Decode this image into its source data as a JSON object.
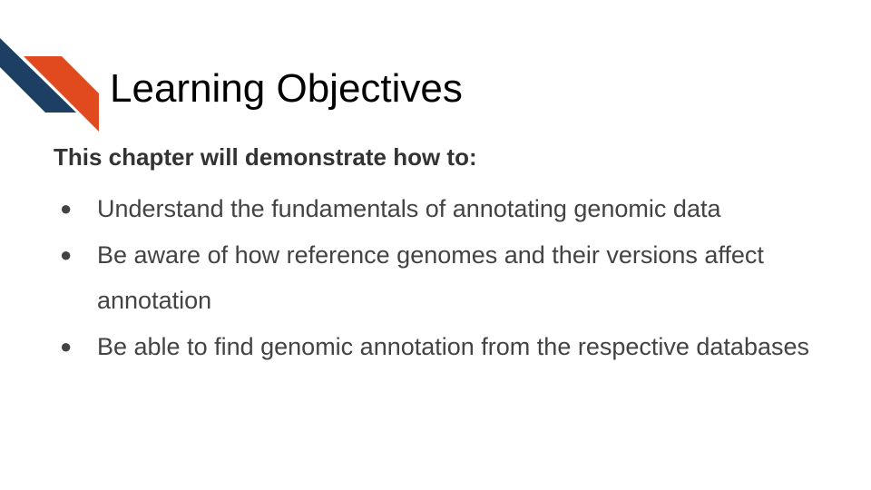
{
  "slide": {
    "title": "Learning Objectives",
    "intro": "This chapter will demonstrate how to:",
    "bullet_glyph": "●",
    "objectives": [
      {
        "text": "Understand the fundamentals of annotating genomic data"
      },
      {
        "text": "Be aware of how reference genomes and their versions affect annotation"
      },
      {
        "text": "Be able to find genomic annotation from the respective databases"
      }
    ]
  },
  "colors": {
    "logo_navy": "#1c3f63",
    "logo_orange": "#e04a1e",
    "title_text": "#000000",
    "body_text": "#434343"
  },
  "icons": {
    "logo": "diagonal-chevron-logo-icon"
  }
}
